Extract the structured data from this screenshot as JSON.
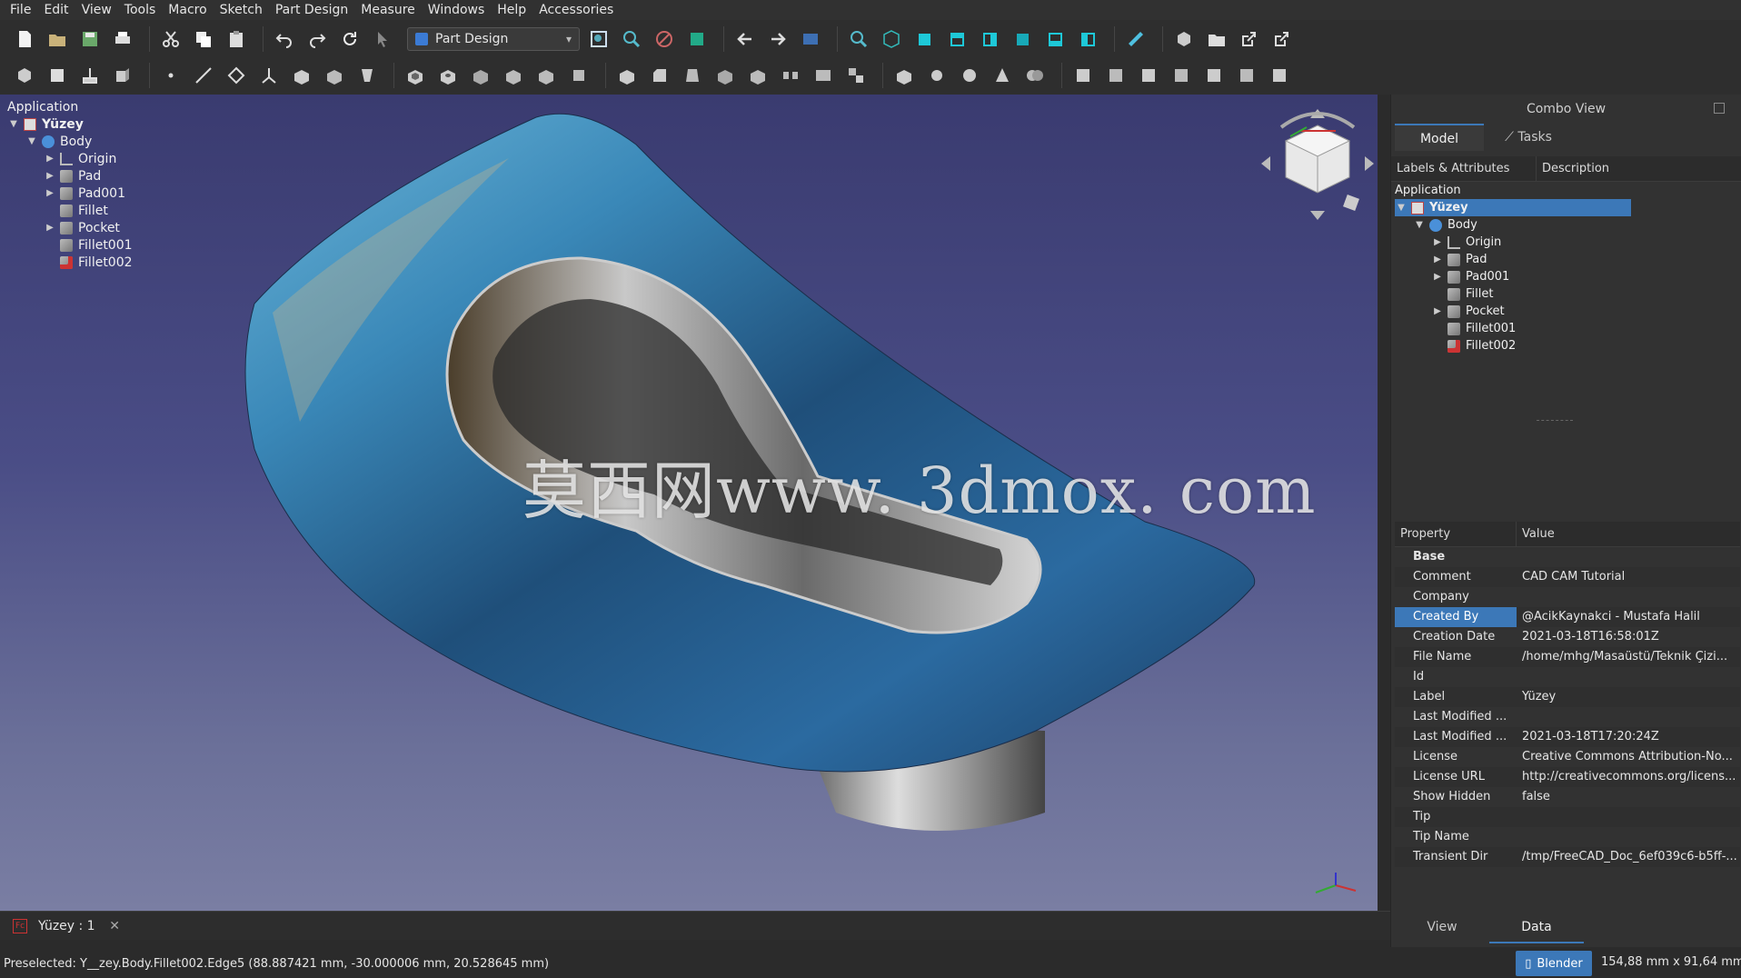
{
  "menu": [
    "File",
    "Edit",
    "View",
    "Tools",
    "Macro",
    "Sketch",
    "Part Design",
    "Measure",
    "Windows",
    "Help",
    "Accessories"
  ],
  "toolbar": {
    "workbench": "Part Design"
  },
  "tree": {
    "root_label": "Application",
    "document": "Yüzey",
    "body": "Body",
    "features": [
      "Origin",
      "Pad",
      "Pad001",
      "Fillet",
      "Pocket",
      "Fillet001",
      "Fillet002"
    ]
  },
  "viewport": {
    "watermark": "莫西网www. 3dmox. com"
  },
  "doc_tab": {
    "label": "Yüzey : 1"
  },
  "status": {
    "text": "Preselected: Y__zey.Body.Fillet002.Edge5 (88.887421 mm, -30.000006 mm, 20.528645 mm)",
    "nav_style": "Blender",
    "dimensions": "154,88 mm x 91,64 mm"
  },
  "combo": {
    "title": "Combo View",
    "tabs": [
      "Model",
      "Tasks"
    ],
    "tree_headers": [
      "Labels & Attributes",
      "Description"
    ],
    "tree_root": "Application",
    "document": "Yüzey",
    "body": "Body",
    "features": [
      "Origin",
      "Pad",
      "Pad001",
      "Fillet",
      "Pocket",
      "Fillet001",
      "Fillet002"
    ]
  },
  "properties": {
    "headers": [
      "Property",
      "Value"
    ],
    "group": "Base",
    "rows": [
      {
        "name": "Comment",
        "value": "CAD CAM Tutorial"
      },
      {
        "name": "Company",
        "value": ""
      },
      {
        "name": "Created By",
        "value": "@AcikKaynakci - Mustafa Halil"
      },
      {
        "name": "Creation Date",
        "value": "2021-03-18T16:58:01Z"
      },
      {
        "name": "File Name",
        "value": "/home/mhg/Masaüstü/Teknik Çizi..."
      },
      {
        "name": "Id",
        "value": ""
      },
      {
        "name": "Label",
        "value": "Yüzey"
      },
      {
        "name": "Last Modified ...",
        "value": ""
      },
      {
        "name": "Last Modified ...",
        "value": "2021-03-18T17:20:24Z"
      },
      {
        "name": "License",
        "value": "Creative Commons Attribution-No..."
      },
      {
        "name": "License URL",
        "value": "http://creativecommons.org/licens..."
      },
      {
        "name": "Show Hidden",
        "value": "false"
      },
      {
        "name": "Tip",
        "value": ""
      },
      {
        "name": "Tip Name",
        "value": ""
      },
      {
        "name": "Transient Dir",
        "value": "/tmp/FreeCAD_Doc_6ef039c6-b5ff-..."
      }
    ],
    "bottom_tabs": [
      "View",
      "Data"
    ]
  },
  "colors": {
    "accent": "#3c78b8",
    "viewport_top": "#3a3b70",
    "viewport_bottom": "#7a7ea3"
  }
}
